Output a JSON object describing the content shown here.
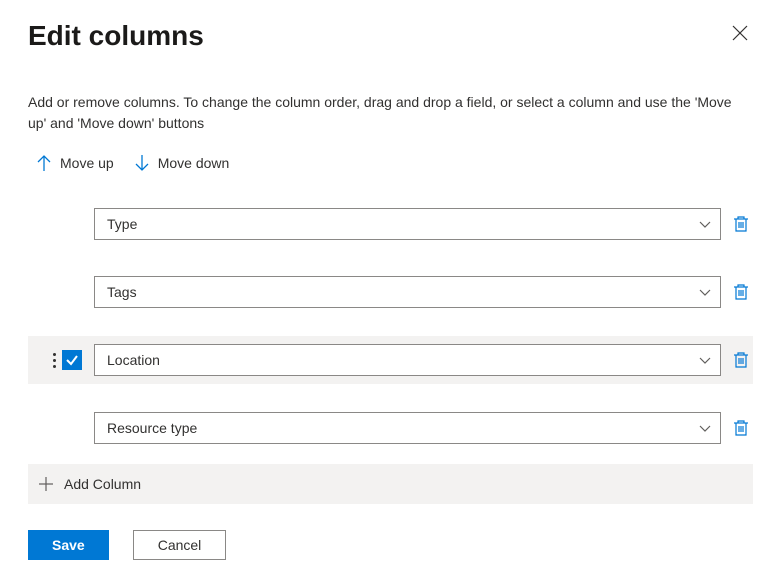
{
  "header": {
    "title": "Edit columns"
  },
  "description": "Add or remove columns. To change the column order, drag and drop a field, or select a column and use the 'Move up' and 'Move down' buttons",
  "toolbar": {
    "move_up_label": "Move up",
    "move_down_label": "Move down"
  },
  "columns": [
    {
      "label": "Type",
      "selected": false
    },
    {
      "label": "Tags",
      "selected": false
    },
    {
      "label": "Location",
      "selected": true
    },
    {
      "label": "Resource type",
      "selected": false
    }
  ],
  "add_column_label": "Add Column",
  "footer": {
    "save_label": "Save",
    "cancel_label": "Cancel"
  },
  "colors": {
    "primary": "#0078d4",
    "border": "#8a8886",
    "text": "#323130",
    "row_bg": "#f3f2f1"
  }
}
